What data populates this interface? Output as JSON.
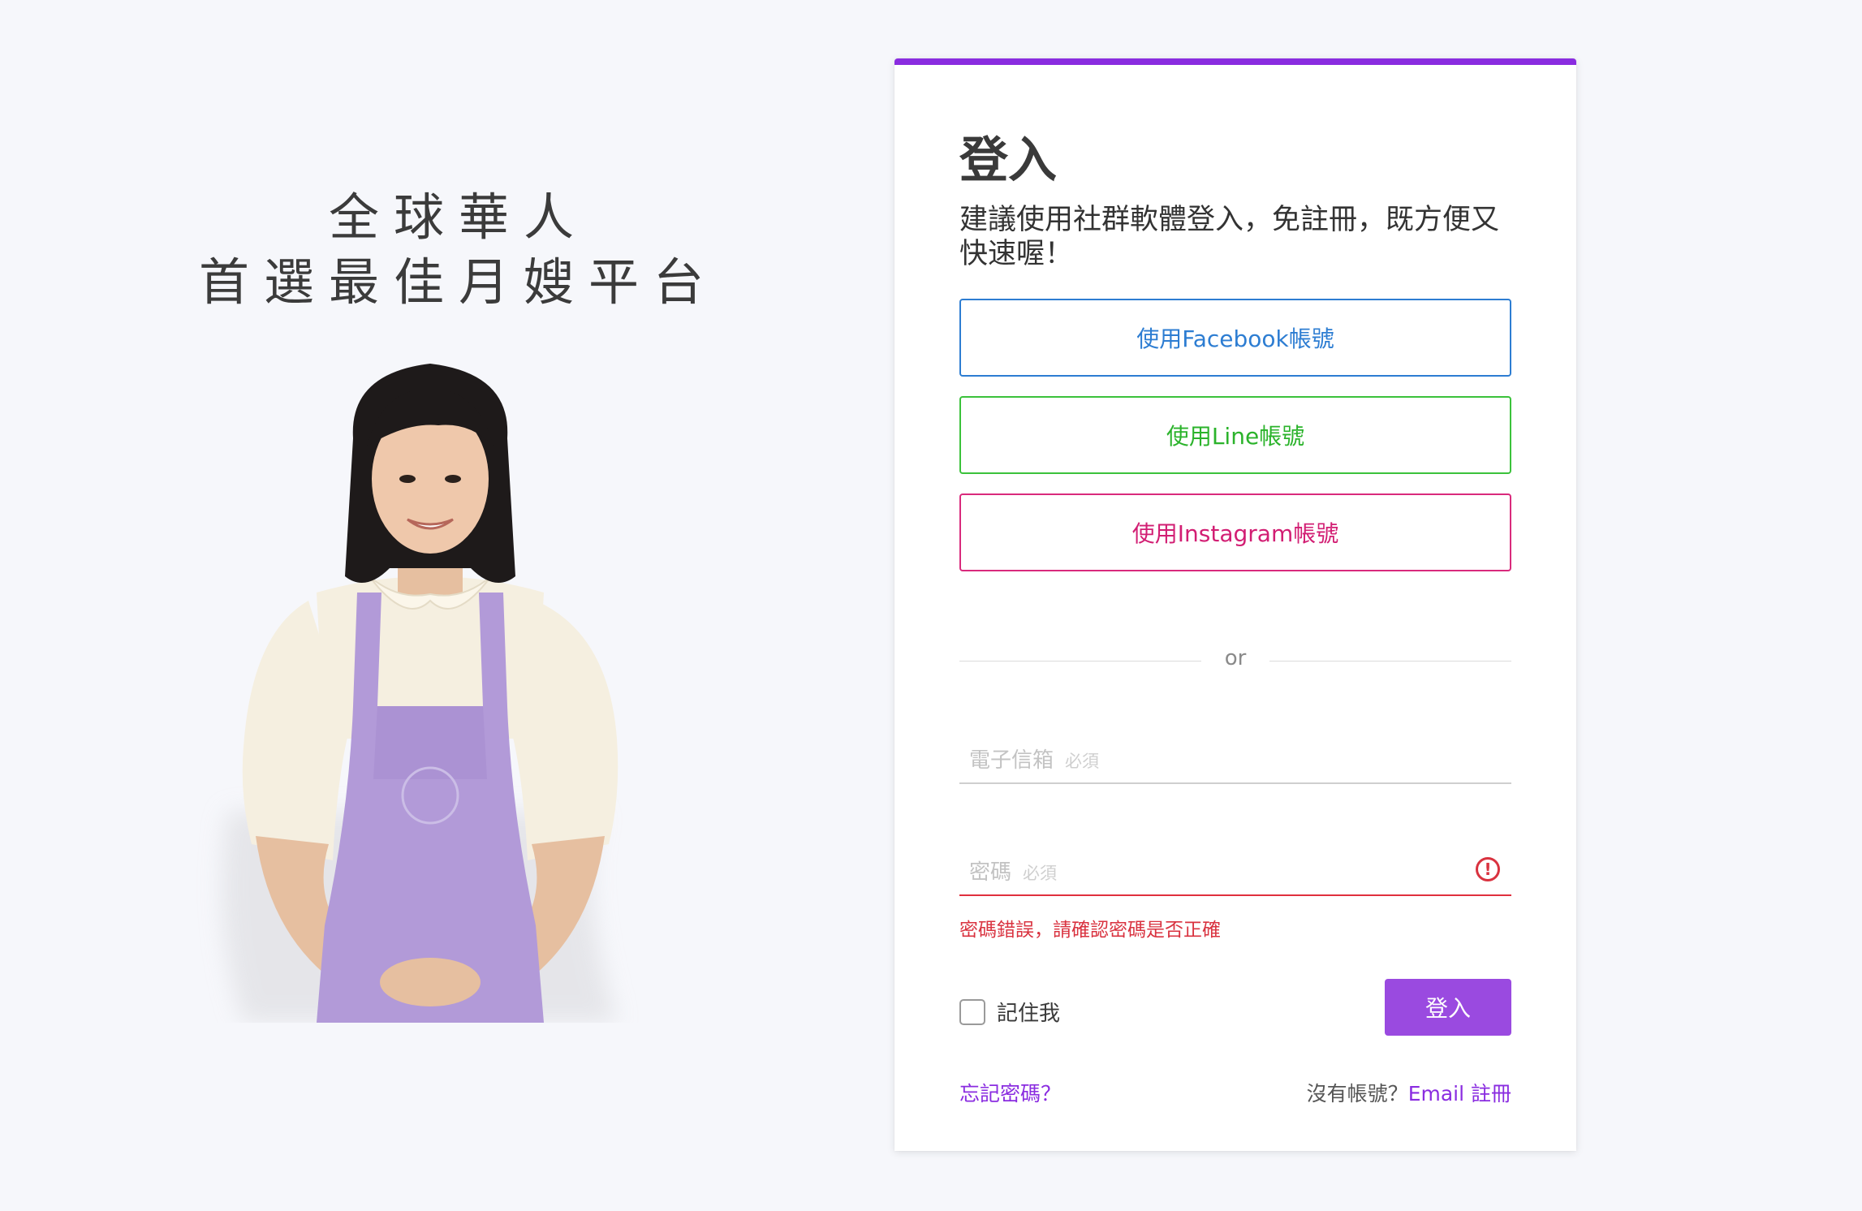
{
  "hero": {
    "tagline_line1": "全球華人",
    "tagline_line2": "首選最佳月嫂平台"
  },
  "login": {
    "title": "登入",
    "subtitle": "建議使用社群軟體登入，免註冊，既方便又快速喔！",
    "facebook_label": "使用Facebook帳號",
    "line_label": "使用Line帳號",
    "instagram_label": "使用Instagram帳號",
    "divider_text": "or",
    "email": {
      "label": "電子信箱",
      "required": "必須",
      "value": ""
    },
    "password": {
      "label": "密碼",
      "required": "必須",
      "value": "",
      "error_icon": "!",
      "error_message": "密碼錯誤，請確認密碼是否正確"
    },
    "remember_label": "記住我",
    "login_button": "登入",
    "forgot_link": "忘記密碼？",
    "signup_prompt": "沒有帳號？",
    "signup_link": "Email 註冊"
  },
  "colors": {
    "accent": "#8a2ce0",
    "facebook": "#2d7dd2",
    "line": "#3bc23b",
    "instagram": "#d92a7c",
    "error": "#d9323f"
  },
  "icons": {
    "error_icon": "exclamation-circle-icon",
    "checkbox": "checkbox-unchecked-icon"
  }
}
